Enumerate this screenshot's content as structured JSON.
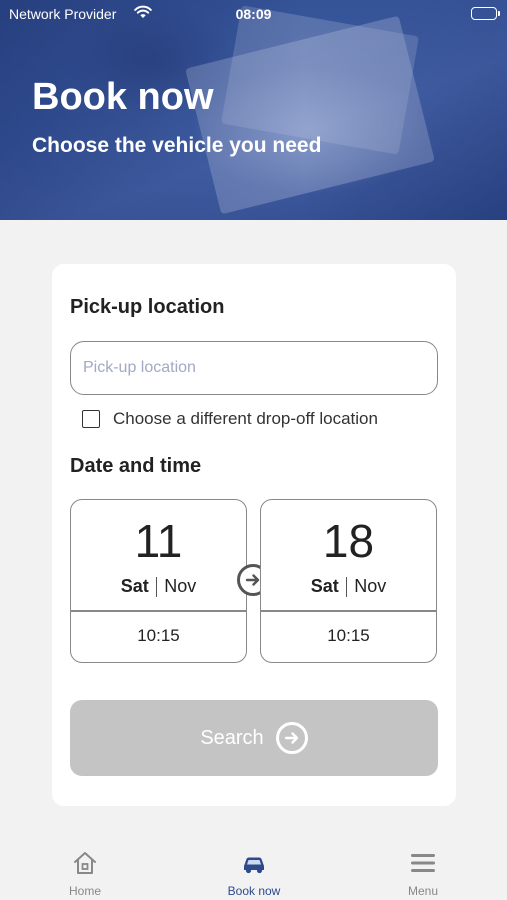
{
  "status_bar": {
    "carrier": "Network Provider",
    "time": "08:09",
    "wifi_icon": "wifi-icon",
    "battery_icon": "battery-icon"
  },
  "hero": {
    "title": "Book now",
    "subtitle": "Choose the vehicle you need"
  },
  "form": {
    "pickup_section_title": "Pick-up location",
    "pickup_input": {
      "placeholder": "Pick-up location",
      "value": ""
    },
    "different_dropoff": {
      "label": "Choose a different drop-off location",
      "checked": false
    },
    "date_section_title": "Date and time",
    "pickup_date": {
      "day": "11",
      "weekday": "Sat",
      "month": "Nov",
      "time": "10:15"
    },
    "return_date": {
      "day": "18",
      "weekday": "Sat",
      "month": "Nov",
      "time": "10:15"
    },
    "date_arrow_icon": "arrow-right-circle-icon",
    "search_button": {
      "label": "Search",
      "icon": "arrow-right-circle-icon",
      "enabled": false
    }
  },
  "tabbar": {
    "items": [
      {
        "label": "Home",
        "icon": "home-icon",
        "active": false
      },
      {
        "label": "Book now",
        "icon": "car-icon",
        "active": true
      },
      {
        "label": "Menu",
        "icon": "hamburger-menu-icon",
        "active": false
      }
    ]
  },
  "colors": {
    "brand": "#2e4a8c",
    "disabled_button": "#c4c4c4",
    "background": "#f2f2f2",
    "placeholder": "#a3a8c3"
  }
}
